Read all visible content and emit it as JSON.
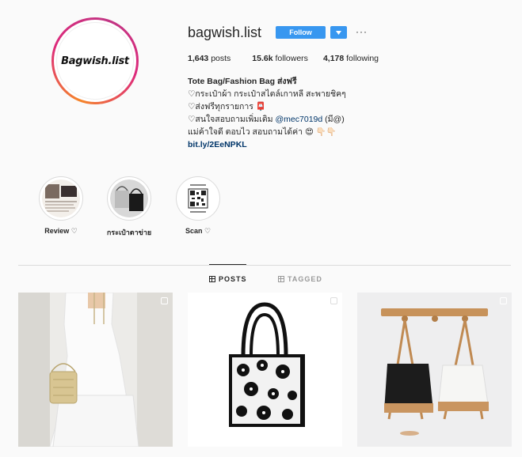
{
  "profile": {
    "avatar_text": "Bagwish.list",
    "username": "bagwish.list",
    "follow_label": "Follow",
    "dropdown_icon": "caret-down-icon",
    "more_icon": "more-horizontal-icon",
    "more_label": "···"
  },
  "stats": {
    "posts_count": "1,643",
    "posts_label": " posts",
    "followers_count": "15.6k",
    "followers_label": " followers",
    "following_count": "4,178",
    "following_label": " following"
  },
  "bio": {
    "name": "Tote Bag/Fashion Bag ส่งฟรี",
    "line1": "♡กระเป๋าผ้า กระเป๋าสไตล์เกาหลี สะพายชิคๆ",
    "line2": "♡ส่งฟรีทุกรายการ 📮",
    "line3_prefix": "♡สนใจสอบถามเพิ่มเติม ",
    "line3_mention": "@mec7019d",
    "line3_suffix": " (มี@)",
    "line4": "แม่ค้าใจดี ตอบไว สอบถามได้ค่า 😍 👇🏻👇🏻",
    "link": "bit.ly/2EeNPKL"
  },
  "highlights": [
    {
      "label": "Review ♡"
    },
    {
      "label": "กระเป๋าตาข่าย"
    },
    {
      "label": "Scan ♡"
    }
  ],
  "tabs": {
    "posts": "POSTS",
    "tagged": "TAGGED"
  },
  "colors": {
    "accent": "#3897f0",
    "text": "#262626",
    "link": "#003569",
    "background": "#fafafa"
  }
}
